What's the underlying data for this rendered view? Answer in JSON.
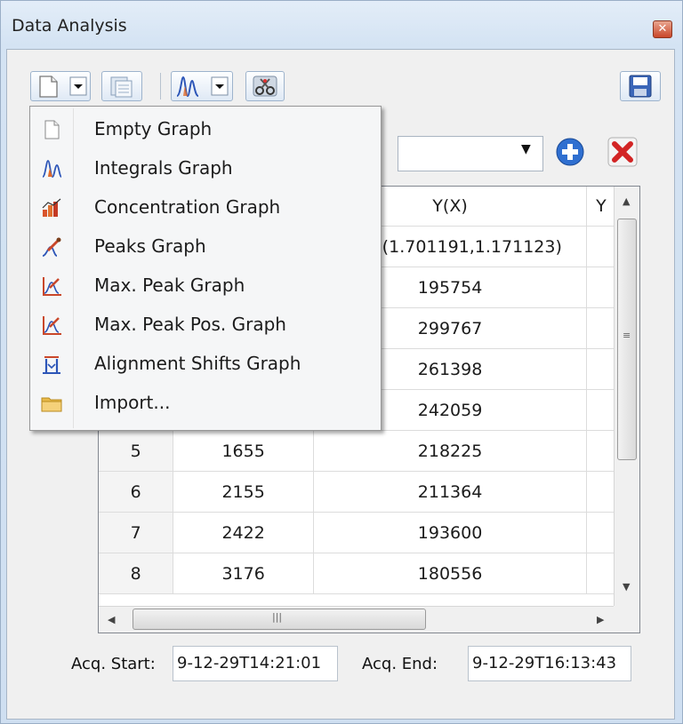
{
  "window": {
    "title": "Data Analysis"
  },
  "icons": {
    "new_graph": "new-document-icon",
    "copy": "copy-icon",
    "graph_type": "integrals-graph-icon",
    "tools": "scissors-wrench-icon",
    "save": "save-disk-icon",
    "add": "plus-icon",
    "remove": "delete-x-icon",
    "close": "close-icon"
  },
  "menu": {
    "items": [
      {
        "label": "Empty Graph",
        "icon": "empty-page-icon"
      },
      {
        "label": "Integrals Graph",
        "icon": "integrals-graph-icon"
      },
      {
        "label": "Concentration Graph",
        "icon": "concentration-graph-icon"
      },
      {
        "label": "Peaks Graph",
        "icon": "peaks-graph-icon"
      },
      {
        "label": "Max. Peak Graph",
        "icon": "max-peak-graph-icon"
      },
      {
        "label": "Max. Peak Pos. Graph",
        "icon": "max-peak-pos-graph-icon"
      },
      {
        "label": "Alignment Shifts Graph",
        "icon": "alignment-shifts-graph-icon"
      },
      {
        "label": "Import...",
        "icon": "folder-icon"
      }
    ]
  },
  "combo": {
    "value": ""
  },
  "table": {
    "headers": [
      "",
      "",
      "Y(X)",
      "Y"
    ],
    "rows": [
      [
        "",
        "",
        "ral(1.701191,1.171123)",
        ""
      ],
      [
        "",
        "",
        "195754",
        ""
      ],
      [
        "",
        "",
        "299767",
        ""
      ],
      [
        "",
        "",
        "261398",
        ""
      ],
      [
        "",
        "",
        "242059",
        ""
      ],
      [
        "5",
        "1655",
        "218225",
        ""
      ],
      [
        "6",
        "2155",
        "211364",
        ""
      ],
      [
        "7",
        "2422",
        "193600",
        ""
      ],
      [
        "8",
        "3176",
        "180556",
        ""
      ]
    ]
  },
  "footer": {
    "start_label": "Acq. Start:",
    "start_value": "9-12-29T14:21:01",
    "end_label": "Acq. End:",
    "end_value": "9-12-29T16:13:43"
  },
  "colors": {
    "accent": "#2f6fd0",
    "delete": "#d22424"
  }
}
